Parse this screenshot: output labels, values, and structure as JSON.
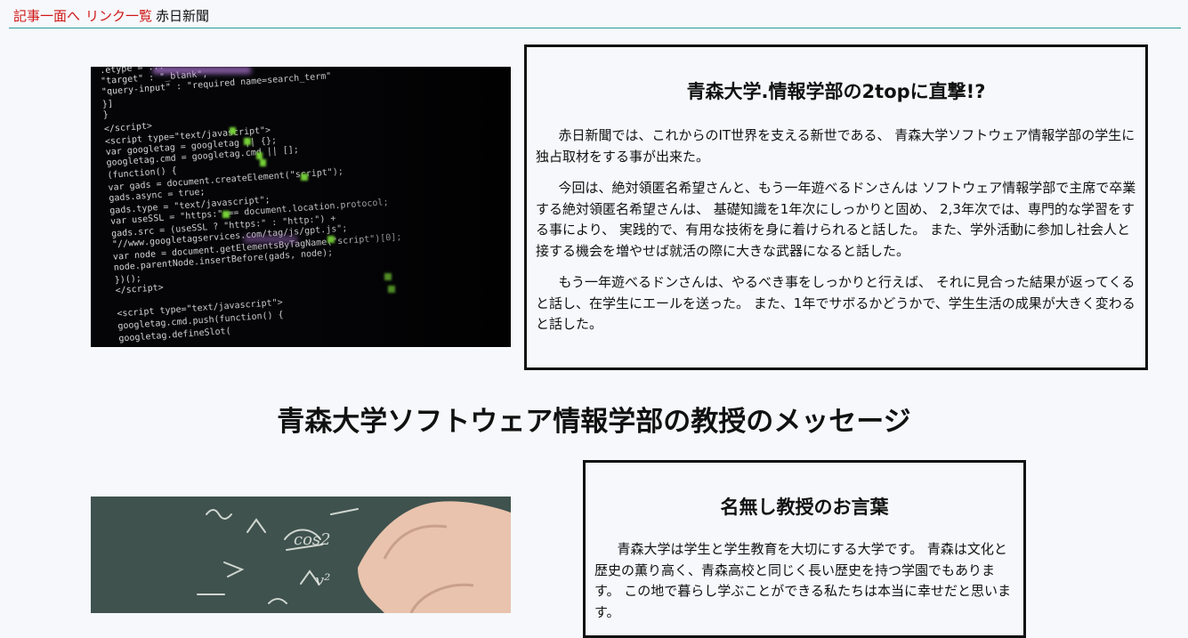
{
  "nav": {
    "link_article_top": "記事一面へ",
    "link_list": "リンク一覧",
    "site_name": "赤日新聞"
  },
  "article1": {
    "title": "青森大学.情報学部の2topに直撃!?",
    "paragraphs": [
      "赤日新聞では、これからのIT世界を支える新世である、 青森大学ソフトウェア情報学部の学生に独占取材をする事が出来た。",
      "今回は、絶対領匿名希望さんと、もう一年遊べるドンさんは ソフトウェア情報学部で主席で卒業する絶対領匿名希望さんは、 基礎知識を1年次にしっかりと固め、 2,3年次では、専門的な学習をする事により、 実践的で、有用な技術を身に着けられると話した。 また、学外活動に参加し社会人と接する機会を増やせば就活の際に大きな武器になると話した。",
      "もう一年遊べるドンさんは、やるべき事をしっかりと行えば、 それに見合った結果が返ってくると話し、在学生にエールを送った。 また、1年でサボるかどうかで、学生生活の成果が大きく変わると話した。"
    ]
  },
  "section_title": "青森大学ソフトウェア情報学部の教授のメッセージ",
  "article2": {
    "title": "名無し教授のお言葉",
    "paragraphs": [
      "青森大学は学生と学生教育を大切にする大学です。 青森は文化と歴史の薫り高く、青森高校と同じく長い歴史を持つ学園でもあります。 この地で暮らし学ぶことができる私たちは本当に幸せだと思います。"
    ]
  },
  "colors": {
    "link": "#d01616",
    "nav_rule": "#2a9a9a",
    "background": "#f6f8fb",
    "card_border": "#111111"
  }
}
